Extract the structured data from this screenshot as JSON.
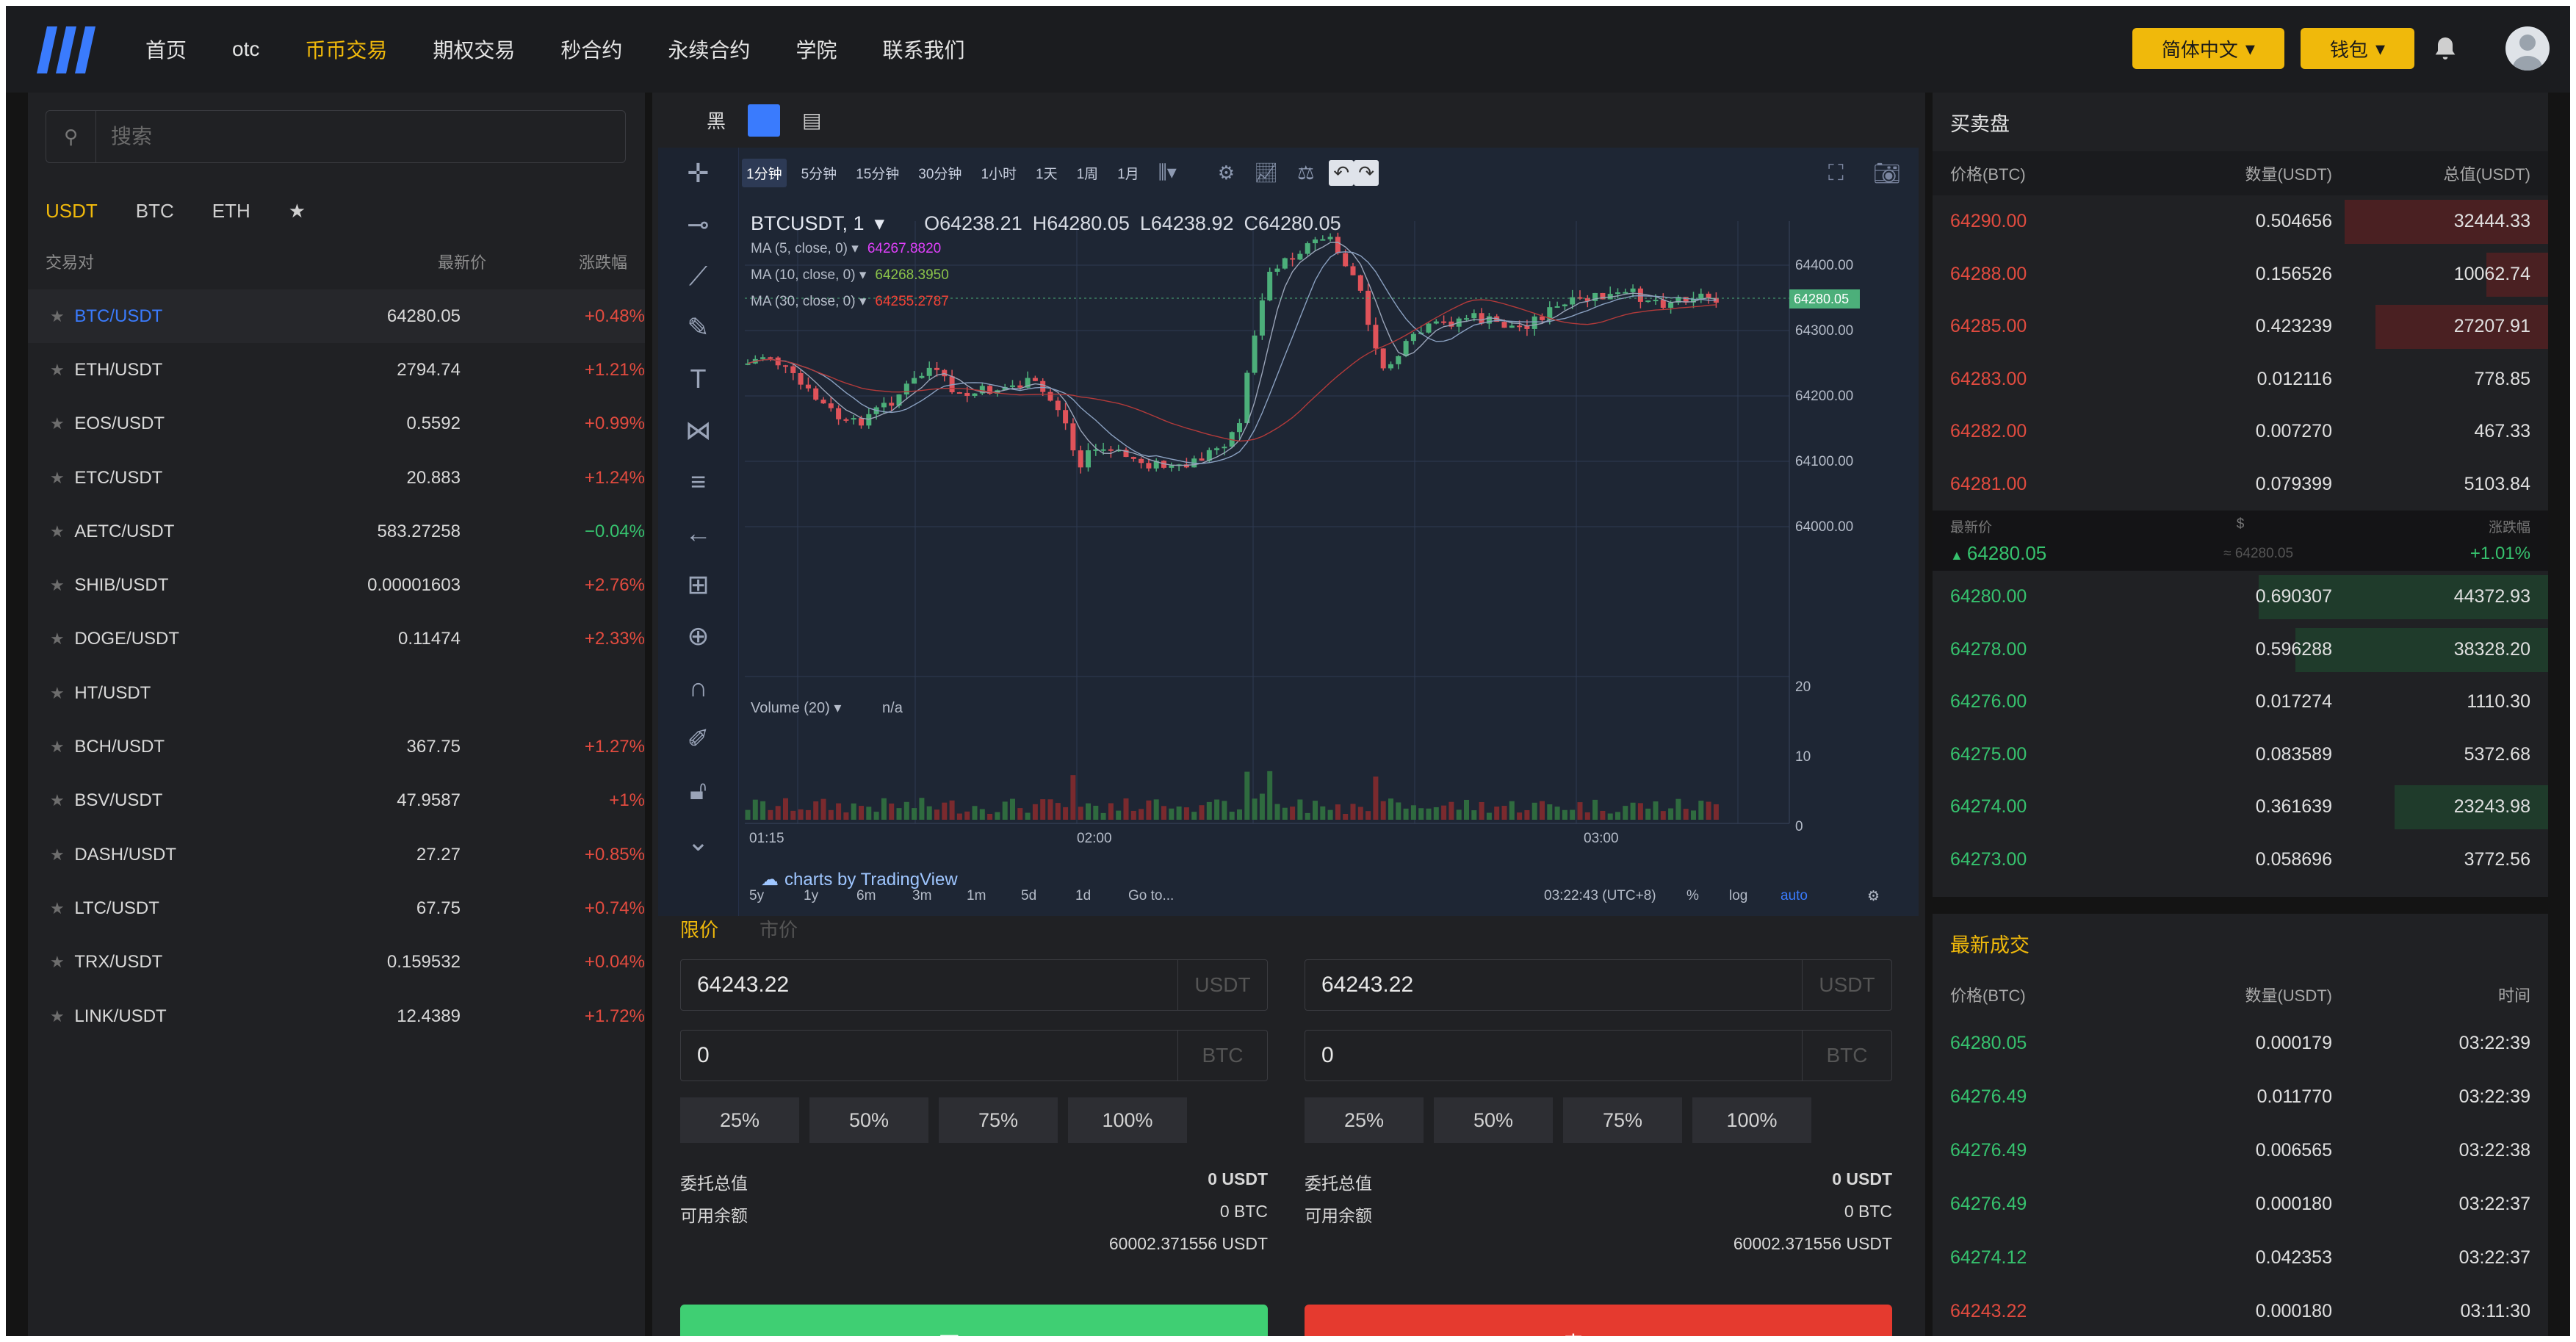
{
  "nav": {
    "items": [
      "首页",
      "otc",
      "币币交易",
      "期权交易",
      "秒合约",
      "永续合约",
      "学院",
      "联系我们"
    ],
    "active_index": 2,
    "language": "简体中文",
    "wallet": "钱包"
  },
  "market": {
    "search_placeholder": "搜索",
    "quote_tabs": [
      "USDT",
      "BTC",
      "ETH",
      "★"
    ],
    "headers": [
      "交易对",
      "最新价",
      "涨跌幅"
    ],
    "pairs": [
      {
        "name": "BTC/USDT",
        "price": "64280.05",
        "change": "+0.48%"
      },
      {
        "name": "ETH/USDT",
        "price": "2794.74",
        "change": "+1.21%"
      },
      {
        "name": "EOS/USDT",
        "price": "0.5592",
        "change": "+0.99%"
      },
      {
        "name": "ETC/USDT",
        "price": "20.883",
        "change": "+1.24%"
      },
      {
        "name": "AETC/USDT",
        "price": "583.27258",
        "change": "−0.04%"
      },
      {
        "name": "SHIB/USDT",
        "price": "0.00001603",
        "change": "+2.76%"
      },
      {
        "name": "DOGE/USDT",
        "price": "0.11474",
        "change": "+2.33%"
      },
      {
        "name": "HT/USDT",
        "price": "",
        "change": ""
      },
      {
        "name": "BCH/USDT",
        "price": "367.75",
        "change": "+1.27%"
      },
      {
        "name": "BSV/USDT",
        "price": "47.9587",
        "change": "+1%"
      },
      {
        "name": "DASH/USDT",
        "price": "27.27",
        "change": "+0.85%"
      },
      {
        "name": "LTC/USDT",
        "price": "67.75",
        "change": "+0.74%"
      },
      {
        "name": "TRX/USDT",
        "price": "0.159532",
        "change": "+0.04%"
      },
      {
        "name": "LINK/USDT",
        "price": "12.4389",
        "change": "+1.72%"
      }
    ]
  },
  "chart": {
    "theme_label": "黑",
    "timeframes": [
      "1分钟",
      "5分钟",
      "15分钟",
      "30分钟",
      "1小时",
      "1天",
      "1周",
      "1月"
    ],
    "symbol": "BTCUSDT, 1",
    "ohlc": {
      "o": "O64238.21",
      "h": "H64280.05",
      "l": "L64238.92",
      "c": "C64280.05"
    },
    "ma": [
      {
        "label": "MA (5, close, 0)",
        "value": "64267.8820",
        "color": "#e040fb"
      },
      {
        "label": "MA (10, close, 0)",
        "value": "64268.3950",
        "color": "#8bc34a"
      },
      {
        "label": "MA (30, close, 0)",
        "value": "64255.2787",
        "color": "#f44336"
      }
    ],
    "volume_label": "Volume (20)",
    "volume_value": "n/a",
    "price_axis": [
      "64400.00",
      "64300.00",
      "64200.00",
      "64100.00",
      "64000.00"
    ],
    "last_price_tag": "64280.05",
    "volume_axis": [
      "20",
      "10",
      "0"
    ],
    "time_axis": [
      "01:15",
      "02:00",
      "03:00"
    ],
    "ranges": [
      "5y",
      "1y",
      "6m",
      "3m",
      "1m",
      "5d",
      "1d",
      "Go to..."
    ],
    "clock": "03:22:43 (UTC+8)",
    "scale_opts": [
      "%",
      "log",
      "auto"
    ],
    "watermark": "charts by TradingView"
  },
  "order": {
    "tabs": [
      "限价",
      "市价"
    ],
    "buy": {
      "price": "64243.22",
      "price_unit": "USDT",
      "amount": "0",
      "amount_unit": "BTC",
      "total_label": "委托总值",
      "total": "0 USDT",
      "avail_label": "可用余额",
      "avail_btc": "0 BTC",
      "avail_usdt": "60002.371556 USDT",
      "button": "买 BTC"
    },
    "sell": {
      "price": "64243.22",
      "price_unit": "USDT",
      "amount": "0",
      "amount_unit": "BTC",
      "total_label": "委托总值",
      "total": "0 USDT",
      "avail_label": "可用余额",
      "avail_btc": "0 BTC",
      "avail_usdt": "60002.371556 USDT",
      "button": "卖 BTC"
    },
    "percents": [
      "25%",
      "50%",
      "75%",
      "100%"
    ]
  },
  "orderbook": {
    "title": "买卖盘",
    "headers": [
      "价格(BTC)",
      "数量(USDT)",
      "总值(USDT)"
    ],
    "asks": [
      {
        "price": "64290.00",
        "qty": "0.504656",
        "total": "32444.33",
        "depth": 0.33
      },
      {
        "price": "64288.00",
        "qty": "0.156526",
        "total": "10062.74",
        "depth": 0.1
      },
      {
        "price": "64285.00",
        "qty": "0.423239",
        "total": "27207.91",
        "depth": 0.28
      },
      {
        "price": "64283.00",
        "qty": "0.012116",
        "total": "778.85",
        "depth": 0.0
      },
      {
        "price": "64282.00",
        "qty": "0.007270",
        "total": "467.33",
        "depth": 0.0
      },
      {
        "price": "64281.00",
        "qty": "0.079399",
        "total": "5103.84",
        "depth": 0.0
      }
    ],
    "mid": {
      "label_last": "最新价",
      "label_usd": "$",
      "label_change": "涨跌幅",
      "price": "64280.05",
      "approx": "≈ 64280.05",
      "change": "+1.01%"
    },
    "bids": [
      {
        "price": "64280.00",
        "qty": "0.690307",
        "total": "44372.93",
        "depth": 0.47
      },
      {
        "price": "64278.00",
        "qty": "0.596288",
        "total": "38328.20",
        "depth": 0.41
      },
      {
        "price": "64276.00",
        "qty": "0.017274",
        "total": "1110.30",
        "depth": 0.0
      },
      {
        "price": "64275.00",
        "qty": "0.083589",
        "total": "5372.68",
        "depth": 0.0
      },
      {
        "price": "64274.00",
        "qty": "0.361639",
        "total": "23243.98",
        "depth": 0.25
      },
      {
        "price": "64273.00",
        "qty": "0.058696",
        "total": "3772.56",
        "depth": 0.0
      }
    ]
  },
  "trades": {
    "title": "最新成交",
    "headers": [
      "价格(BTC)",
      "数量(USDT)",
      "时间"
    ],
    "rows": [
      {
        "price": "64280.05",
        "qty": "0.000179",
        "time": "03:22:39",
        "side": "buy"
      },
      {
        "price": "64276.49",
        "qty": "0.011770",
        "time": "03:22:39",
        "side": "buy"
      },
      {
        "price": "64276.49",
        "qty": "0.006565",
        "time": "03:22:38",
        "side": "buy"
      },
      {
        "price": "64276.49",
        "qty": "0.000180",
        "time": "03:22:37",
        "side": "buy"
      },
      {
        "price": "64274.12",
        "qty": "0.042353",
        "time": "03:22:37",
        "side": "buy"
      },
      {
        "price": "64243.22",
        "qty": "0.000180",
        "time": "03:11:30",
        "side": "sell"
      }
    ]
  },
  "colors": {
    "accent": "#f0b90b",
    "up": "#36c26e",
    "down": "#e24b3f",
    "link": "#3a7bfd"
  }
}
